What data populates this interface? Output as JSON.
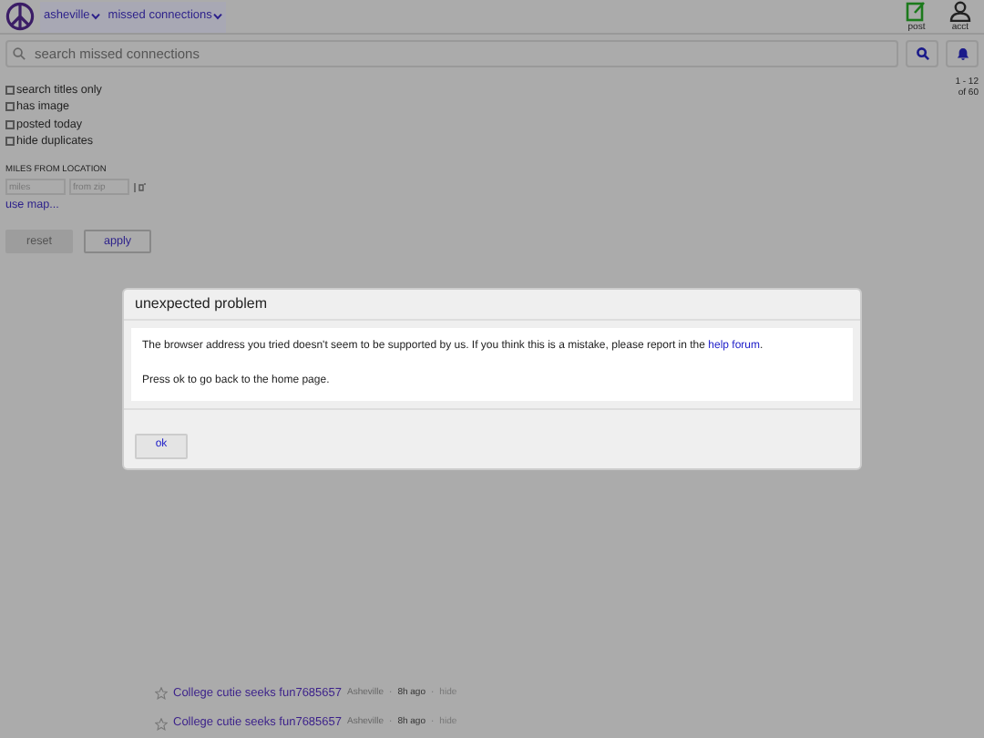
{
  "header": {
    "location": "asheville",
    "category": "missed connections",
    "actions": [
      {
        "kind": "post",
        "label": "post"
      },
      {
        "kind": "account",
        "label": "acct"
      }
    ]
  },
  "search": {
    "placeholder": "search missed connections"
  },
  "filters": [
    {
      "label": "search titles only",
      "checked": false
    },
    {
      "label": "has image",
      "checked": false
    },
    {
      "label": "posted today",
      "checked": false
    },
    {
      "label": "hide duplicates",
      "checked": false
    }
  ],
  "distance": {
    "label": "MILES FROM LOCATION",
    "miles_placeholder": "miles",
    "zip_placeholder": "from zip",
    "map_link": "use map..."
  },
  "buttons": [
    {
      "label": "reset",
      "disabled": true
    },
    {
      "label": "apply",
      "disabled": false
    }
  ],
  "count": [
    "1 - 12",
    "of 60"
  ],
  "dialog": {
    "title": "unexpected problem",
    "message": "The browser address you tried doesn't seem to be supported by us. If you think this is a mistake, please report in the",
    "link": "help forum",
    "link_end": ".",
    "note": "Press ok to go back to the home page.",
    "button": "ok"
  },
  "results": [
    {
      "title": "College cutie seeks fun7685657",
      "location": "Asheville",
      "age": "8h ago",
      "action": "hide",
      "separator": "·"
    },
    {
      "title": "College cutie seeks fun7685657",
      "location": "Asheville",
      "age": "8h ago",
      "action": "hide",
      "separator": "·"
    }
  ]
}
